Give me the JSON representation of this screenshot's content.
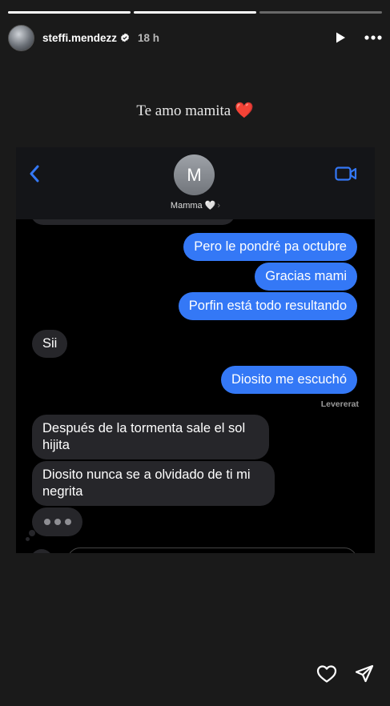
{
  "story": {
    "progress": [
      1,
      1,
      0
    ],
    "username": "steffi.mendezz",
    "time": "18 h",
    "caption": "Te amo mamita ❤️"
  },
  "chat": {
    "contact_initial": "M",
    "contact_name": "Mamma 🤍",
    "contact_chevron": "›",
    "messages": [
      {
        "dir": "out",
        "text": "Pero le pondré pa octubre"
      },
      {
        "dir": "out",
        "text": "Gracias mami"
      },
      {
        "dir": "out",
        "text": "Porfin está todo resultando"
      },
      {
        "dir": "in",
        "text": "Sii"
      },
      {
        "dir": "out",
        "text": "Diosito me escuchó"
      },
      {
        "dir": "in",
        "text": "Después de la tormenta sale el sol hijita"
      },
      {
        "dir": "in",
        "text": "Diosito nunca se a olvidado de ti mi negrita"
      }
    ],
    "delivered_label": "Levererat"
  },
  "icons": {
    "play": "play-icon",
    "more": "more-icon",
    "back": "chevron-left-icon",
    "video": "video-camera-icon",
    "like": "heart-icon",
    "share": "send-icon",
    "verified": "verified-badge-icon"
  },
  "colors": {
    "background": "#1a1a1a",
    "outgoing_bubble": "#3478f6",
    "incoming_bubble": "#26262a",
    "accent_blue": "#3478f6"
  }
}
